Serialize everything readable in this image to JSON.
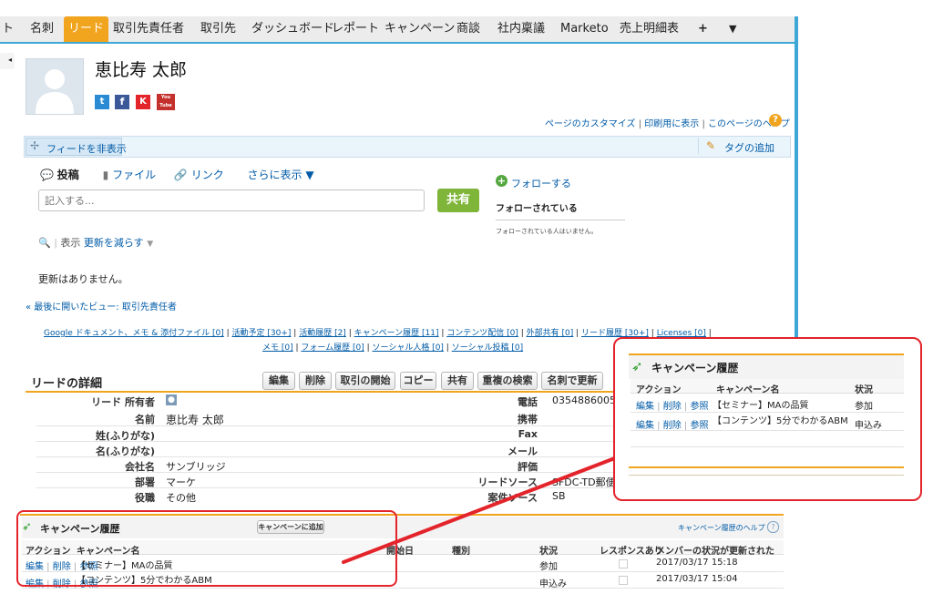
{
  "nav": {
    "tabs": [
      "ト",
      "名刺",
      "リード",
      "取引先責任者",
      "取引先",
      "ダッシュボード",
      "レポート",
      "キャンペーン",
      "商談",
      "社内稟議",
      "Marketo",
      "売上明細表",
      "+",
      "▼"
    ]
  },
  "profile": {
    "name": "恵比寿 太郎",
    "social": [
      "t",
      "f",
      "K",
      "You Tube"
    ]
  },
  "toplinks": {
    "customize": "ページのカスタマイズ",
    "print": "印刷用に表示",
    "help": "このページのヘルプ"
  },
  "feedbar": {
    "hide": "フィードを非表示",
    "tag": "タグの追加"
  },
  "publisher": {
    "post": "投稿",
    "file": "ファイル",
    "link": "リンク",
    "more": "さらに表示 ▼",
    "placeholder": "記入する...",
    "share": "共有"
  },
  "follow": {
    "follow": "フォローする",
    "followers_title": "フォローされている",
    "no_followers": "フォローされている人はいません。"
  },
  "filter": {
    "label": "表示",
    "value": "更新を減らす"
  },
  "no_updates": "更新はありません。",
  "last_view": "« 最後に開いたビュー: 取引先責任者",
  "related_links": {
    "line1": [
      "Google ドキュメント、メモ & 添付ファイル [0]",
      "活動予定 [30+]",
      "活動履歴 [2]",
      "キャンペーン履歴 [11]",
      "コンテンツ配信 [0]",
      "外部共有 [0]",
      "リード履歴 [30+]",
      "Licenses [0]"
    ],
    "line2": [
      "メモ [0]",
      "フォーム履歴 [0]",
      "ソーシャル人格 [0]",
      "ソーシャル投稿 [0]"
    ]
  },
  "detail": {
    "title": "リードの詳細",
    "buttons": [
      "編集",
      "削除",
      "取引の開始",
      "コピー",
      "共有",
      "重複の検索",
      "名刺で更新"
    ],
    "left_fields": [
      {
        "label": "リード 所有者",
        "value": ""
      },
      {
        "label": "名前",
        "value": "恵比寿 太郎"
      },
      {
        "label": "姓(ふりがな)",
        "value": ""
      },
      {
        "label": "名(ふりがな)",
        "value": ""
      },
      {
        "label": "会社名",
        "value": "サンブリッジ"
      },
      {
        "label": "部署",
        "value": "マーケ"
      },
      {
        "label": "役職",
        "value": "その他"
      }
    ],
    "right_fields": [
      {
        "label": "電話",
        "value": "0354886005"
      },
      {
        "label": "携帯",
        "value": ""
      },
      {
        "label": "Fax",
        "value": ""
      },
      {
        "label": "メール",
        "value": ""
      },
      {
        "label": "評価",
        "value": ""
      },
      {
        "label": "リードソース",
        "value": "SFDC-TD郵便"
      },
      {
        "label": "案件ソース",
        "value": "SB"
      }
    ]
  },
  "campaign": {
    "title": "キャンペーン履歴",
    "add_button": "キャンペーンに追加",
    "help": "キャンペーン履歴のヘルプ",
    "headers": [
      "アクション",
      "キャンペーン名",
      "開始日",
      "種別",
      "状況",
      "レスポンスあり",
      "メンバーの状況が更新された"
    ],
    "actions": [
      "編集",
      "削除",
      "参照"
    ],
    "rows": [
      {
        "name": "【セミナー】MAの品質",
        "status": "参加",
        "updated": "2017/03/17 15:18"
      },
      {
        "name": "【コンテンツ】5分でわかるABM",
        "status": "申込み",
        "updated": "2017/03/17 15:04"
      }
    ]
  },
  "zoom": {
    "title": "キャンペーン履歴",
    "headers": [
      "アクション",
      "キャンペーン名",
      "状況"
    ],
    "rows": [
      {
        "name": "【セミナー】MAの品質",
        "status": "参加"
      },
      {
        "name": "【コンテンツ】5分でわかるABM",
        "status": "申込み"
      }
    ]
  },
  "colors": {
    "accent": "#f1a41d",
    "nav_border": "#3da8d6",
    "highlight": "#e3242b",
    "share": "#7fb539"
  }
}
